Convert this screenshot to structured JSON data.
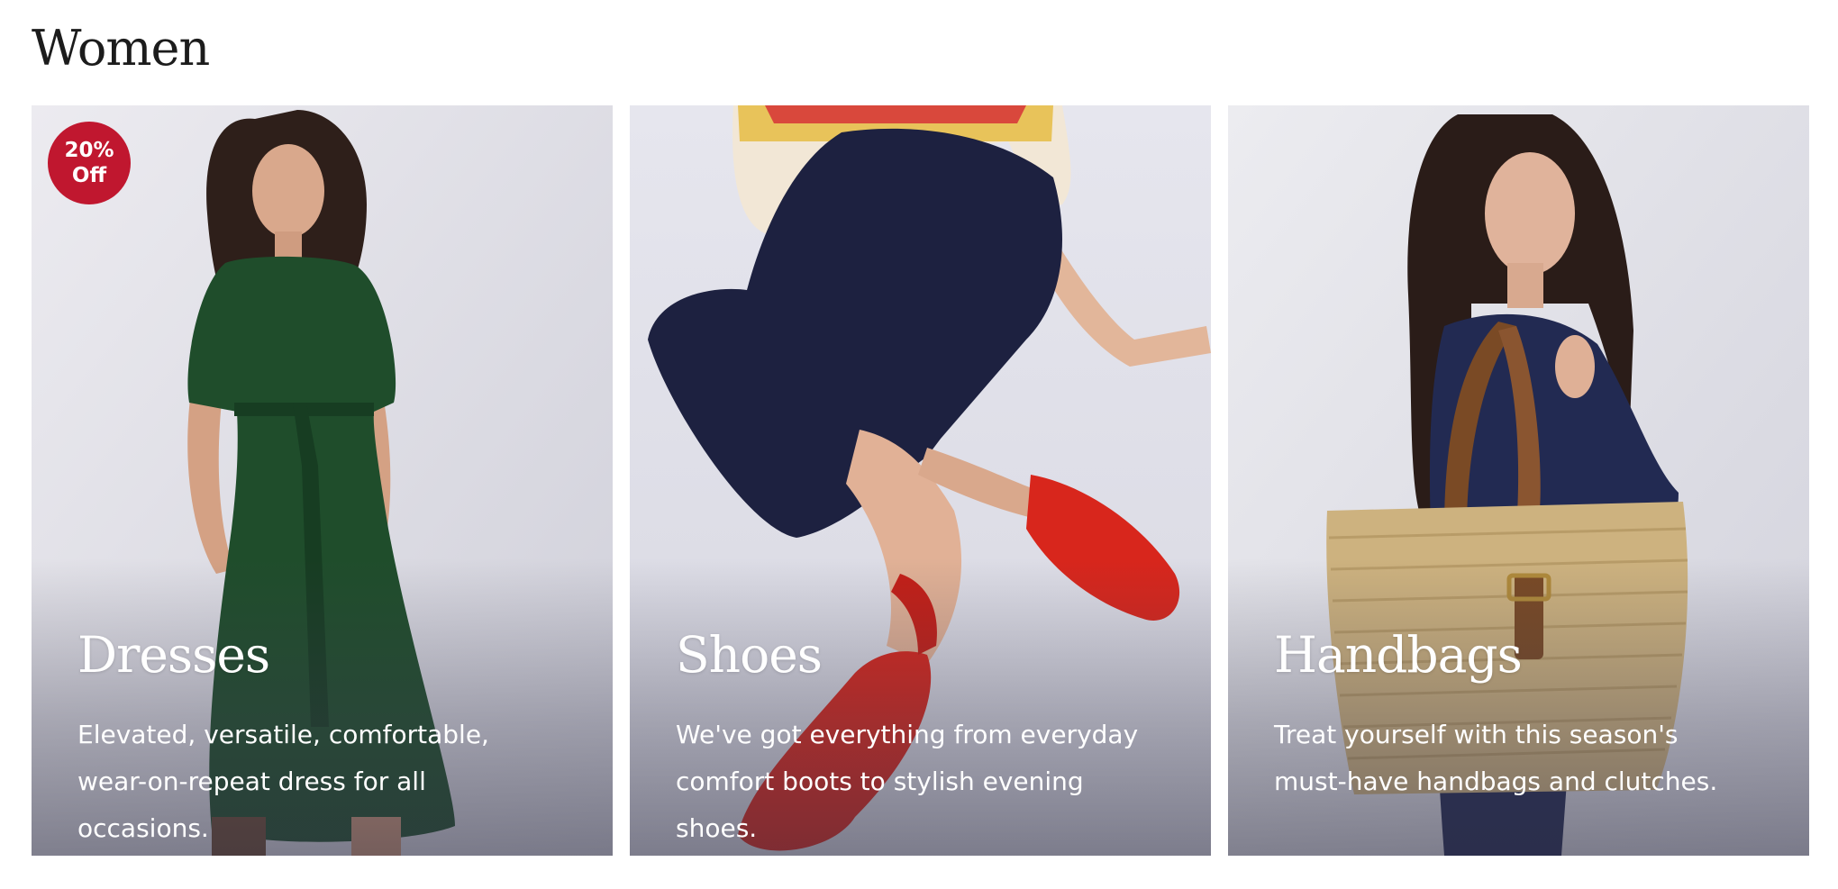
{
  "page": {
    "title": "Women"
  },
  "cards": [
    {
      "title": "Dresses",
      "description": "Elevated, versatile, comfortable, wear-on-repeat dress for all occasions.",
      "badge": "20% Off"
    },
    {
      "title": "Shoes",
      "description": "We've got everything from everyday comfort boots to stylish evening shoes."
    },
    {
      "title": "Handbags",
      "description": "Treat yourself with this season's must-have handbags and clutches."
    }
  ],
  "colors": {
    "badge": "#c0172f",
    "dress": "#1f4d2b",
    "shoes": "#d8261c",
    "denim": "#1d2140",
    "straw": "#cdb27f"
  }
}
